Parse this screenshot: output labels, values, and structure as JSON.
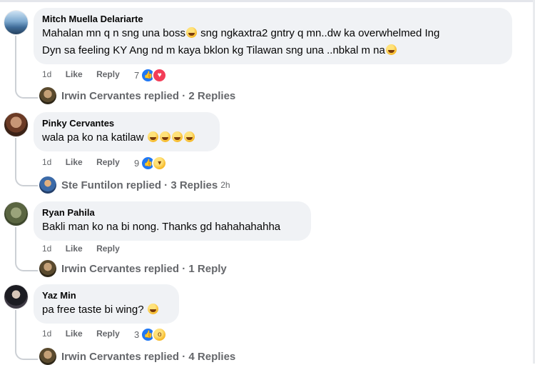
{
  "comments": [
    {
      "author": "Mitch Muella Delariarte",
      "line1": "Mahalan mn q n sng una boss",
      "line1_after": " sng ngkaxtra2 gntry q mn..dw ka overwhelmed Ing",
      "line2": "Dyn sa feeling KY Ang nd m kaya bklon kg Tilawan sng una ..nbkal m na",
      "time": "1d",
      "like": "Like",
      "reply": "Reply",
      "reactions_count": "7",
      "reaction_types": [
        "like-icon",
        "love-icon"
      ],
      "replied_by": "Irwin Cervantes replied · 2 Replies",
      "replied_time": ""
    },
    {
      "author": "Pinky Cervantes",
      "line1": "wala pa ko na katilaw",
      "time": "1d",
      "like": "Like",
      "reply": "Reply",
      "reactions_count": "9",
      "reaction_types": [
        "like-icon",
        "haha-icon"
      ],
      "replied_by": "Ste Funtilon replied · 3 Replies",
      "replied_time": "2h"
    },
    {
      "author": "Ryan Pahila",
      "line1": "Bakli man ko na bi nong. Thanks gd hahahahahha",
      "time": "1d",
      "like": "Like",
      "reply": "Reply",
      "replied_by": "Irwin Cervantes replied · 1 Reply",
      "replied_time": ""
    },
    {
      "author": "Yaz Min",
      "line1": "pa free taste bi wing?",
      "time": "1d",
      "like": "Like",
      "reply": "Reply",
      "reactions_count": "3",
      "reaction_types": [
        "like-icon",
        "wow-icon"
      ],
      "replied_by": "Irwin Cervantes replied · 4 Replies",
      "replied_time": ""
    }
  ],
  "colors": {
    "bubble": "#f0f2f5",
    "meta": "#65676b",
    "like": "#2078f4",
    "love": "#f33e58"
  }
}
